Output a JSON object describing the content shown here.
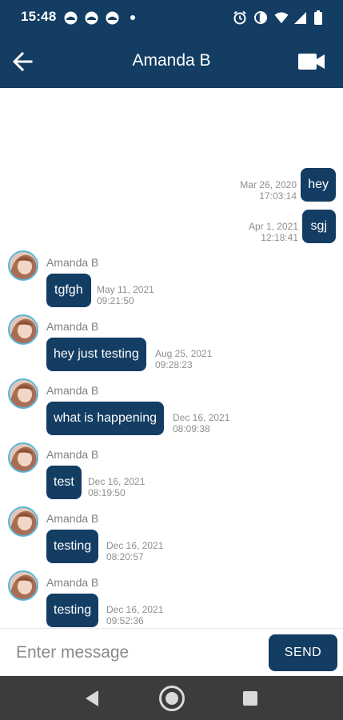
{
  "status_bar": {
    "time": "15:48",
    "icons": [
      "notification-icon",
      "notification-icon",
      "notification-icon",
      "dot-icon",
      "alarm-icon",
      "data-saver-icon",
      "wifi-icon",
      "signal-icon",
      "battery-icon"
    ]
  },
  "header": {
    "title": "Amanda B",
    "back_icon": "arrow-left-icon",
    "video_icon": "video-camera-icon"
  },
  "messages": [
    {
      "direction": "outgoing",
      "text": "hey",
      "date": "Mar 26, 2020",
      "time": "17:03:14"
    },
    {
      "direction": "outgoing",
      "text": "sgj",
      "date": "Apr 1, 2021",
      "time": "12:18:41"
    },
    {
      "direction": "incoming",
      "sender": "Amanda B",
      "text": "tgfgh",
      "date": "May 11, 2021",
      "time": "09:21:50"
    },
    {
      "direction": "incoming",
      "sender": "Amanda B",
      "text": "hey just testing",
      "date": "Aug 25, 2021",
      "time": "09:28:23"
    },
    {
      "direction": "incoming",
      "sender": "Amanda B",
      "text": "what is happening",
      "date": "Dec 16, 2021",
      "time": "08:09:38"
    },
    {
      "direction": "incoming",
      "sender": "Amanda B",
      "text": "test",
      "date": "Dec 16, 2021",
      "time": "08:19:50"
    },
    {
      "direction": "incoming",
      "sender": "Amanda B",
      "text": "testing",
      "date": "Dec 16, 2021",
      "time": "08:20:57"
    },
    {
      "direction": "incoming",
      "sender": "Amanda B",
      "text": "testing",
      "date": "Dec 16, 2021",
      "time": "09:52:36"
    }
  ],
  "composer": {
    "placeholder": "Enter message",
    "send_label": "SEND"
  },
  "nav_bar": {
    "icons": [
      "back-triangle-icon",
      "home-circle-icon",
      "recents-square-icon"
    ]
  },
  "colors": {
    "primary": "#133d63",
    "avatar_ring": "#57b6d9",
    "nav_bar": "#3c3c3c"
  }
}
